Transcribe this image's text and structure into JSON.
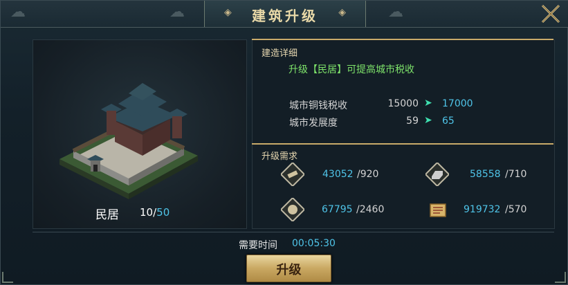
{
  "title": "建筑升级",
  "building": {
    "name": "民居",
    "level": "10",
    "max_level": "50"
  },
  "details": {
    "section_title": "建造详细",
    "description": "升级【民居】可提高城市税收",
    "stats": [
      {
        "label": "城市铜钱税收",
        "old": "15000",
        "new": "17000"
      },
      {
        "label": "城市发展度",
        "old": "59",
        "new": "65"
      }
    ]
  },
  "requirements": {
    "section_title": "升级需求",
    "items": [
      {
        "icon": "wood-icon",
        "have": "43052",
        "need": "/920"
      },
      {
        "icon": "iron-ingot-icon",
        "have": "58558",
        "need": "/710"
      },
      {
        "icon": "grain-icon",
        "have": "67795",
        "need": "/2460"
      },
      {
        "icon": "scroll-icon",
        "have": "919732",
        "need": "/570"
      }
    ]
  },
  "time": {
    "label": "需要时间",
    "value": "00:05:30"
  },
  "upgrade_button": {
    "label": "升级"
  },
  "colors": {
    "accent_blue": "#4fc4e8",
    "accent_green": "#7ee36a",
    "gold": "#c9ab6a"
  }
}
